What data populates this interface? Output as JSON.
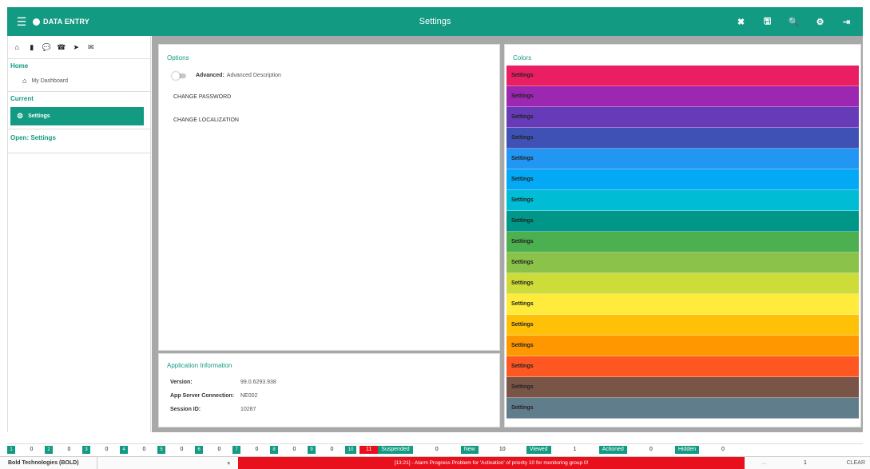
{
  "app": {
    "brand": "DATA ENTRY",
    "title": "Settings",
    "accent_color": "#139a82"
  },
  "toolbar": {
    "actions": [
      {
        "name": "close-icon",
        "glyph": "✖"
      },
      {
        "name": "save-icon",
        "glyph": "🖫"
      },
      {
        "name": "search-icon",
        "glyph": "🔍"
      },
      {
        "name": "settings-icon",
        "glyph": "⚙"
      },
      {
        "name": "logout-icon",
        "glyph": "⇥"
      }
    ]
  },
  "sidebar": {
    "icons": [
      {
        "name": "home-icon",
        "glyph": "⌂"
      },
      {
        "name": "book-icon",
        "glyph": "▮"
      },
      {
        "name": "chat-icon",
        "glyph": "💬"
      },
      {
        "name": "phone-icon",
        "glyph": "☎"
      },
      {
        "name": "send-icon",
        "glyph": "➤"
      },
      {
        "name": "mail-icon",
        "glyph": "✉"
      }
    ],
    "home_title": "Home",
    "home_item": "My Dashboard",
    "current_title": "Current",
    "current_item": "Settings",
    "open_title": "Open: Settings"
  },
  "options": {
    "title": "Options",
    "toggle_label": "Advanced:",
    "toggle_desc": "Advanced Description",
    "change_password": "CHANGE PASSWORD",
    "change_localization": "CHANGE LOCALIZATION"
  },
  "app_info": {
    "title": "Application Information",
    "version_label": "Version:",
    "version_value": "99.0.6293.938",
    "server_label": "App Server Connection:",
    "server_value": "NE002",
    "session_label": "Session ID:",
    "session_value": "10287"
  },
  "colors": {
    "title": "Colors",
    "swatches": [
      {
        "label": "Settings",
        "color": "#e91e63"
      },
      {
        "label": "Settings",
        "color": "#9c27b0"
      },
      {
        "label": "Settings",
        "color": "#673ab7"
      },
      {
        "label": "Settings",
        "color": "#3f51b5"
      },
      {
        "label": "Settings",
        "color": "#2196f3"
      },
      {
        "label": "Settings",
        "color": "#03a9f4"
      },
      {
        "label": "Settings",
        "color": "#00bcd4"
      },
      {
        "label": "Settings",
        "color": "#009688"
      },
      {
        "label": "Settings",
        "color": "#4caf50"
      },
      {
        "label": "Settings",
        "color": "#8bc34a"
      },
      {
        "label": "Settings",
        "color": "#cddc39"
      },
      {
        "label": "Settings",
        "color": "#ffeb3b"
      },
      {
        "label": "Settings",
        "color": "#ffc107"
      },
      {
        "label": "Settings",
        "color": "#ff9800"
      },
      {
        "label": "Settings",
        "color": "#ff5722"
      },
      {
        "label": "Settings",
        "color": "#795548"
      },
      {
        "label": "Settings",
        "color": "#607d8b"
      }
    ]
  },
  "status": {
    "priorities": [
      {
        "n": "1",
        "v": "0"
      },
      {
        "n": "2",
        "v": "0"
      },
      {
        "n": "3",
        "v": "0"
      },
      {
        "n": "4",
        "v": "0"
      },
      {
        "n": "5",
        "v": "0"
      },
      {
        "n": "6",
        "v": "0"
      },
      {
        "n": "7",
        "v": "0"
      },
      {
        "n": "8",
        "v": "0"
      },
      {
        "n": "9",
        "v": "0"
      }
    ],
    "p10_label": "10",
    "p10_value": "11",
    "tags": [
      {
        "label": "Suspended",
        "value": "0"
      },
      {
        "label": "New",
        "value": "10"
      },
      {
        "label": "Viewed",
        "value": "1"
      },
      {
        "label": "Actioned",
        "value": "0"
      },
      {
        "label": "Hidden",
        "value": "0"
      }
    ]
  },
  "footer": {
    "org": "Bold Technologies (BOLD)",
    "dropdown_glyph": "▾",
    "alert": "[13:21] - Alarm Progress Problem for 'Activation' of priority 10 for monitoring group 0!",
    "dots": "...",
    "count": "1",
    "clear": "CLEAR"
  }
}
